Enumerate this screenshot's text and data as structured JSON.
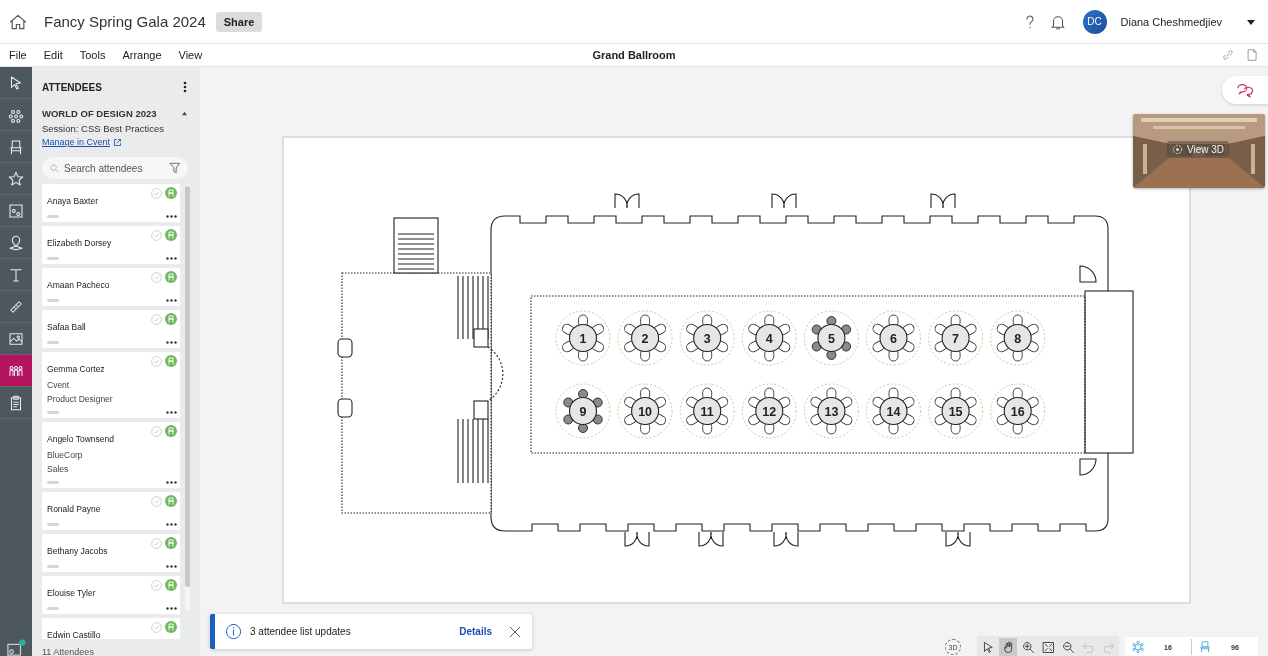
{
  "header": {
    "title": "Fancy Spring Gala 2024",
    "share": "Share",
    "user": {
      "initials": "DC",
      "name": "Diana Cheshmedjiev"
    }
  },
  "menu": [
    "File",
    "Edit",
    "Tools",
    "Arrange",
    "View"
  ],
  "canvas_title": "Grand Ballroom",
  "rail": [
    {
      "selected": false
    },
    {
      "selected": false
    },
    {
      "selected": false
    },
    {
      "selected": false
    },
    {
      "selected": false
    },
    {
      "selected": false
    },
    {
      "selected": false
    },
    {
      "selected": false
    },
    {
      "selected": false
    },
    {
      "selected": true
    },
    {
      "selected": false
    }
  ],
  "panel": {
    "title": "ATTENDEES",
    "event": "WORLD OF DESIGN 2023",
    "expanded": true,
    "session": "Session: CSS Best Practices",
    "manage_link": "Manage in Cvent",
    "search": {
      "placeholder": "Search attendees"
    },
    "attendees": [
      {
        "name": "Anaya Baxter"
      },
      {
        "name": "Elizabeth Dorsey"
      },
      {
        "name": "Amaan Pacheco"
      },
      {
        "name": "Safaa Ball"
      },
      {
        "name": "Gemma Cortez",
        "company": "Cvent",
        "title": "Product Designer"
      },
      {
        "name": "Angelo Townsend",
        "company": "BlueCorp",
        "title": "Sales"
      },
      {
        "name": "Ronald Payne"
      },
      {
        "name": "Bethany Jacobs"
      },
      {
        "name": "Elouise Tyler"
      },
      {
        "name": "Edwin Castillo"
      }
    ],
    "count": "11 Attendees"
  },
  "tables": [
    {
      "number": "1",
      "occupied": false
    },
    {
      "number": "2",
      "occupied": false
    },
    {
      "number": "3",
      "occupied": false
    },
    {
      "number": "4",
      "occupied": false
    },
    {
      "number": "5",
      "occupied": true
    },
    {
      "number": "6",
      "occupied": false
    },
    {
      "number": "7",
      "occupied": false
    },
    {
      "number": "8",
      "occupied": false
    },
    {
      "number": "9",
      "occupied": true
    },
    {
      "number": "10",
      "occupied": false
    },
    {
      "number": "11",
      "occupied": false
    },
    {
      "number": "12",
      "occupied": false
    },
    {
      "number": "13",
      "occupied": false
    },
    {
      "number": "14",
      "occupied": false
    },
    {
      "number": "15",
      "occupied": false
    },
    {
      "number": "16",
      "occupied": false
    }
  ],
  "view3d": "View 3D",
  "toast": {
    "message": "3 attendee list updates",
    "link": "Details"
  },
  "toolbar": {
    "three_d": "3D",
    "tools": [
      {
        "selected": false
      },
      {
        "selected": true
      }
    ],
    "undo": {
      "disabled": true
    },
    "redo": {
      "disabled": true
    },
    "tables_count": "16",
    "seats_count": "96"
  }
}
